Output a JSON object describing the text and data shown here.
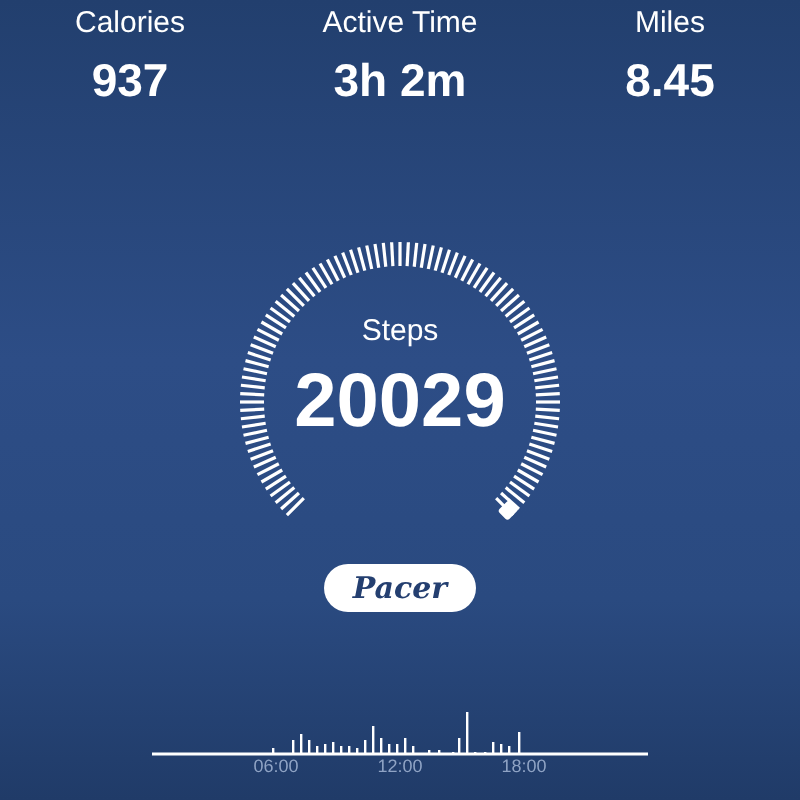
{
  "stats": [
    {
      "label": "Calories",
      "value": "937"
    },
    {
      "label": "Active Time",
      "value": "3h 2m"
    },
    {
      "label": "Miles",
      "value": "8.45"
    }
  ],
  "gauge": {
    "label": "Steps",
    "value": "20029"
  },
  "logo": {
    "text": "Pacer"
  },
  "activity_chart": {
    "kind": "picture",
    "axis_labels": [
      "06:00",
      "12:00",
      "18:00"
    ]
  }
}
